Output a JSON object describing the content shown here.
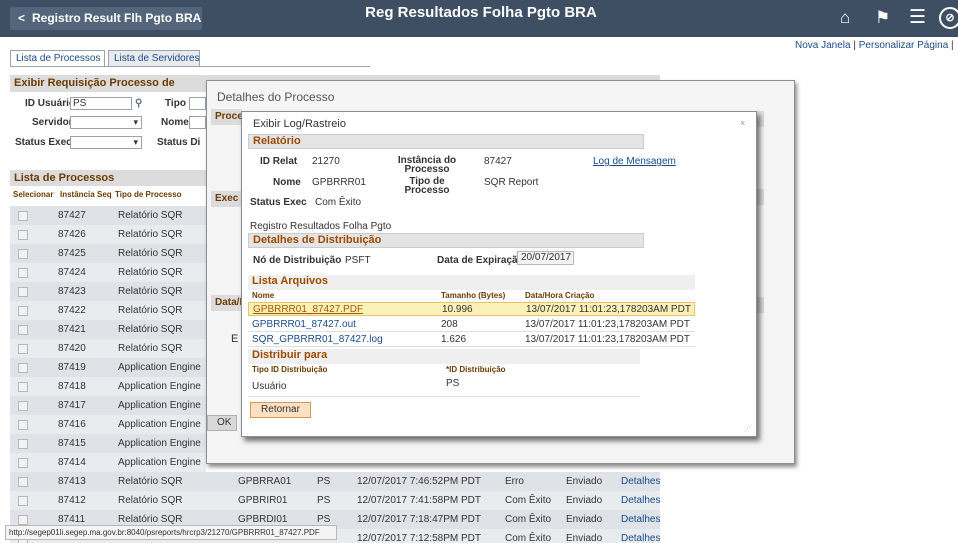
{
  "header": {
    "back_label": "Registro Result Flh Pgto BRA",
    "title": "Reg Resultados Folha Pgto BRA",
    "icons": [
      "home-icon",
      "flag-icon",
      "menu-icon",
      "navigator-icon"
    ]
  },
  "links": {
    "new_window": "Nova Janela",
    "separator": "|",
    "personalize": "Personalizar Página",
    "separator2": "|"
  },
  "tabs": [
    "Lista de Processos",
    "Lista de Servidores"
  ],
  "request": {
    "header": "Exibir Requisição Processo de",
    "user_id_label": "ID Usuário",
    "user_id_value": "PS",
    "type_label": "Tipo",
    "server_label": "Servidor",
    "name_label": "Nome",
    "status_exec_label": "Status Exec",
    "status_dist_label": "Status Di"
  },
  "process_list": {
    "header": "Lista de Processos",
    "columns": [
      "Selecionar",
      "Instância",
      "Seq",
      "Tipo de Processo"
    ],
    "rows": [
      {
        "instance": "87427",
        "type": "Relatório SQR"
      },
      {
        "instance": "87426",
        "type": "Relatório SQR"
      },
      {
        "instance": "87425",
        "type": "Relatório SQR"
      },
      {
        "instance": "87424",
        "type": "Relatório SQR"
      },
      {
        "instance": "87423",
        "type": "Relatório SQR"
      },
      {
        "instance": "87422",
        "type": "Relatório SQR"
      },
      {
        "instance": "87421",
        "type": "Relatório SQR"
      },
      {
        "instance": "87420",
        "type": "Relatório SQR"
      },
      {
        "instance": "87419",
        "type": "Application Engine"
      },
      {
        "instance": "87418",
        "type": "Application Engine"
      },
      {
        "instance": "87417",
        "type": "Application Engine"
      },
      {
        "instance": "87416",
        "type": "Application Engine"
      },
      {
        "instance": "87415",
        "type": "Application Engine"
      },
      {
        "instance": "87414",
        "type": "Application Engine"
      },
      {
        "instance": "87413",
        "type": "Relatório SQR",
        "name": "GPBRRA01",
        "user": "PS",
        "datetime": "12/07/2017  7:46:52PM PDT",
        "status": "Erro",
        "dist": "Enviado",
        "details": "Detalhes"
      },
      {
        "instance": "87412",
        "type": "Relatório SQR",
        "name": "GPBRIR01",
        "user": "PS",
        "datetime": "12/07/2017  7:41:58PM PDT",
        "status": "Com Êxito",
        "dist": "Enviado",
        "details": "Detalhes"
      },
      {
        "instance": "87411",
        "type": "Relatório SQR",
        "name": "GPBRDI01",
        "user": "PS",
        "datetime": "12/07/2017  7:18:47PM PDT",
        "status": "Com Êxito",
        "dist": "Enviado",
        "details": "Detalhes"
      },
      {
        "instance": "",
        "type": "",
        "name": "",
        "user": "",
        "datetime": "12/07/2017  7:12:58PM PDT",
        "status": "Com Êxito",
        "dist": "Enviado",
        "details": "Detalhes"
      }
    ]
  },
  "modal1": {
    "title": "Detalhes do Processo",
    "sec_process": "Proce",
    "sec_exec": "Exec",
    "sec_date": "Data/H",
    "e_label": "E",
    "ok_label": "OK"
  },
  "modal2": {
    "title": "Exibir Log/Rastreio",
    "close": "×",
    "report_header": "Relatório",
    "report_id_label": "ID Relat",
    "report_id": "21270",
    "instance_label": "Instância do Processo",
    "instance": "87427",
    "log_link": "Log de Mensagem",
    "name_label": "Nome",
    "name": "GPBRRR01",
    "proc_type_label": "Tipo de Processo",
    "proc_type": "SQR Report",
    "status_label": "Status Exec",
    "status": "Com Êxito",
    "description": "Registro Resultados Folha Pgto",
    "dist_header": "Detalhes de Distribuição",
    "dist_node_label": "Nó de Distribuição",
    "dist_node": "PSFT",
    "exp_label": "Data de Expiração",
    "exp_date": "20/07/2017",
    "files_header": "Lista Arquivos",
    "files_cols": [
      "Nome",
      "Tamanho (Bytes)",
      "Data/Hora Criação"
    ],
    "files": [
      {
        "name": "GPBRRR01_87427.PDF",
        "size": "10.996",
        "created": "13/07/2017 11:01:23,178203AM PDT"
      },
      {
        "name": "GPBRRR01_87427.out",
        "size": "208",
        "created": "13/07/2017 11:01:23,178203AM PDT"
      },
      {
        "name": "SQR_GPBRRR01_87427.log",
        "size": "1.626",
        "created": "13/07/2017 11:01:23,178203AM PDT"
      }
    ],
    "distribute_header": "Distribuir para",
    "distribute_cols": [
      "Tipo ID Distribuição",
      "*ID Distribuição"
    ],
    "distribute_row": {
      "type": "Usuário",
      "id": "PS"
    },
    "return_label": "Retornar"
  },
  "status_url": "http://segep01li.segep.ma.gov.br:8040/psreports/hrcrp3/21270/GPBRRR01_87427.PDF",
  "colors": {
    "topbar": "#3e4f63",
    "section_text": "#9c4a00",
    "link": "#1a4b8c",
    "highlight_row": "#fbf0b8"
  }
}
